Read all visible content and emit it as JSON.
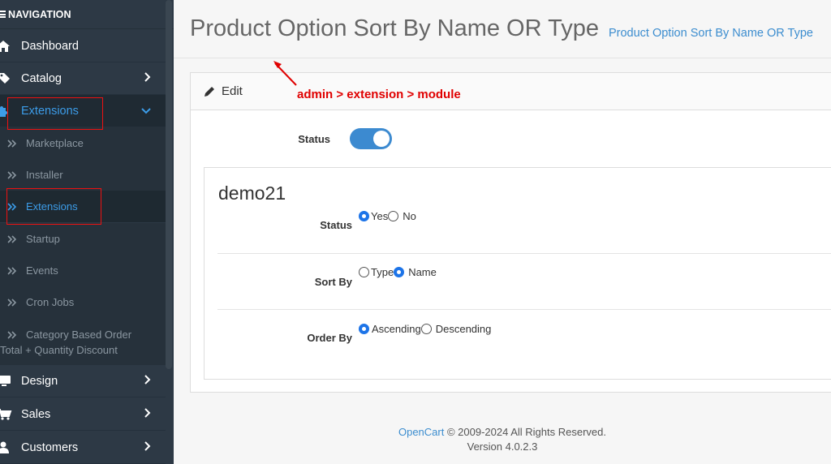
{
  "sidebar": {
    "heading": "NAVIGATION",
    "items": {
      "dashboard": "Dashboard",
      "catalog": "Catalog",
      "extensions": "Extensions",
      "design": "Design",
      "sales": "Sales",
      "customers": "Customers"
    },
    "sub": {
      "marketplace": "Marketplace",
      "installer": "Installer",
      "extensions": "Extensions",
      "startup": "Startup",
      "events": "Events",
      "cron": "Cron Jobs",
      "category_line1": "Category Based Order",
      "category_line2": "Total + Quantity Discount"
    }
  },
  "header": {
    "title": "Product Option Sort By Name OR Type",
    "breadcrumb": "Product Option Sort By Name OR Type"
  },
  "card": {
    "edit_label": "Edit",
    "annotation": "admin > extension > module",
    "status_label": "Status",
    "status_enabled": true
  },
  "store": {
    "name": "demo21",
    "status_label": "Status",
    "status_yes": "Yes",
    "status_no": "No",
    "status_selected": "Yes",
    "sort_label": "Sort By",
    "sort_type": "Type",
    "sort_name": "Name",
    "sort_selected": "Name",
    "order_label": "Order By",
    "order_asc": "Ascending",
    "order_desc": "Descending",
    "order_selected": "Ascending"
  },
  "footer": {
    "brand": "OpenCart",
    "copyright": " © 2009-2024 All Rights Reserved.",
    "version": "Version 4.0.2.3"
  },
  "colors": {
    "sidebar_bg": "#2d3945",
    "accent": "#3c8dcf",
    "annotation_red": "#e00000"
  }
}
